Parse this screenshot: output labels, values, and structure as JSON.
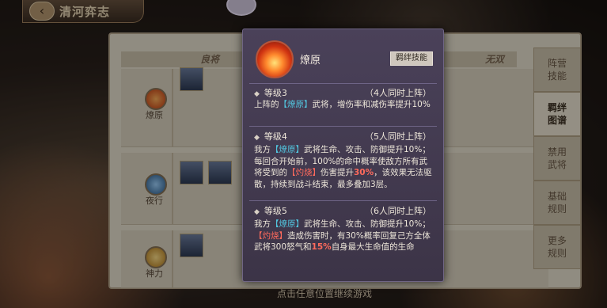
{
  "header": {
    "title": "清河弈志",
    "back_icon": "back-arrow-icon"
  },
  "table": {
    "col_headers": [
      "良将",
      "无双"
    ],
    "rows": [
      {
        "label": "燎原",
        "icon": "flame-icon"
      },
      {
        "label": "夜行",
        "icon": "night-icon"
      },
      {
        "label": "神力",
        "icon": "power-icon"
      }
    ]
  },
  "side_tabs": [
    {
      "label": "阵营\n技能"
    },
    {
      "label": "羁绊\n图谱"
    },
    {
      "label": "禁用\n武将"
    },
    {
      "label": "基础\n规则"
    },
    {
      "label": "更多\n规则"
    }
  ],
  "hint": "点击任意位置继续游戏",
  "popup": {
    "skill_name": "燎原",
    "badge": "羁绊技能",
    "levels": [
      {
        "level": "等级3",
        "count": "（4人同时上阵）",
        "desc": [
          {
            "t": "上阵的"
          },
          {
            "t": "【燎原】",
            "c": "kw"
          },
          {
            "t": "武将，增伤率和减伤率提升10%"
          }
        ]
      },
      {
        "level": "等级4",
        "count": "（5人同时上阵）",
        "desc": [
          {
            "t": "我方"
          },
          {
            "t": "【燎原】",
            "c": "kw"
          },
          {
            "t": "武将生命、攻击、防御提升10%；每回合开始前，100%的命中概率使敌方所有武将受到的"
          },
          {
            "t": "【灼烧】",
            "c": "burn"
          },
          {
            "t": "伤害提升"
          },
          {
            "t": "30%",
            "c": "pct"
          },
          {
            "t": "，该效果无法驱散，持续到战斗结束，最多叠加3层。"
          }
        ]
      },
      {
        "level": "等级5",
        "count": "（6人同时上阵）",
        "desc": [
          {
            "t": "我方"
          },
          {
            "t": "【燎原】",
            "c": "kw"
          },
          {
            "t": "武将生命、攻击、防御提升10%；"
          },
          {
            "t": "【灼烧】",
            "c": "burn"
          },
          {
            "t": "造成伤害时，有30%概率回复己方全体武将300怒气和"
          },
          {
            "t": "15%",
            "c": "pct"
          },
          {
            "t": "自身最大生命值的生命"
          }
        ]
      }
    ]
  }
}
